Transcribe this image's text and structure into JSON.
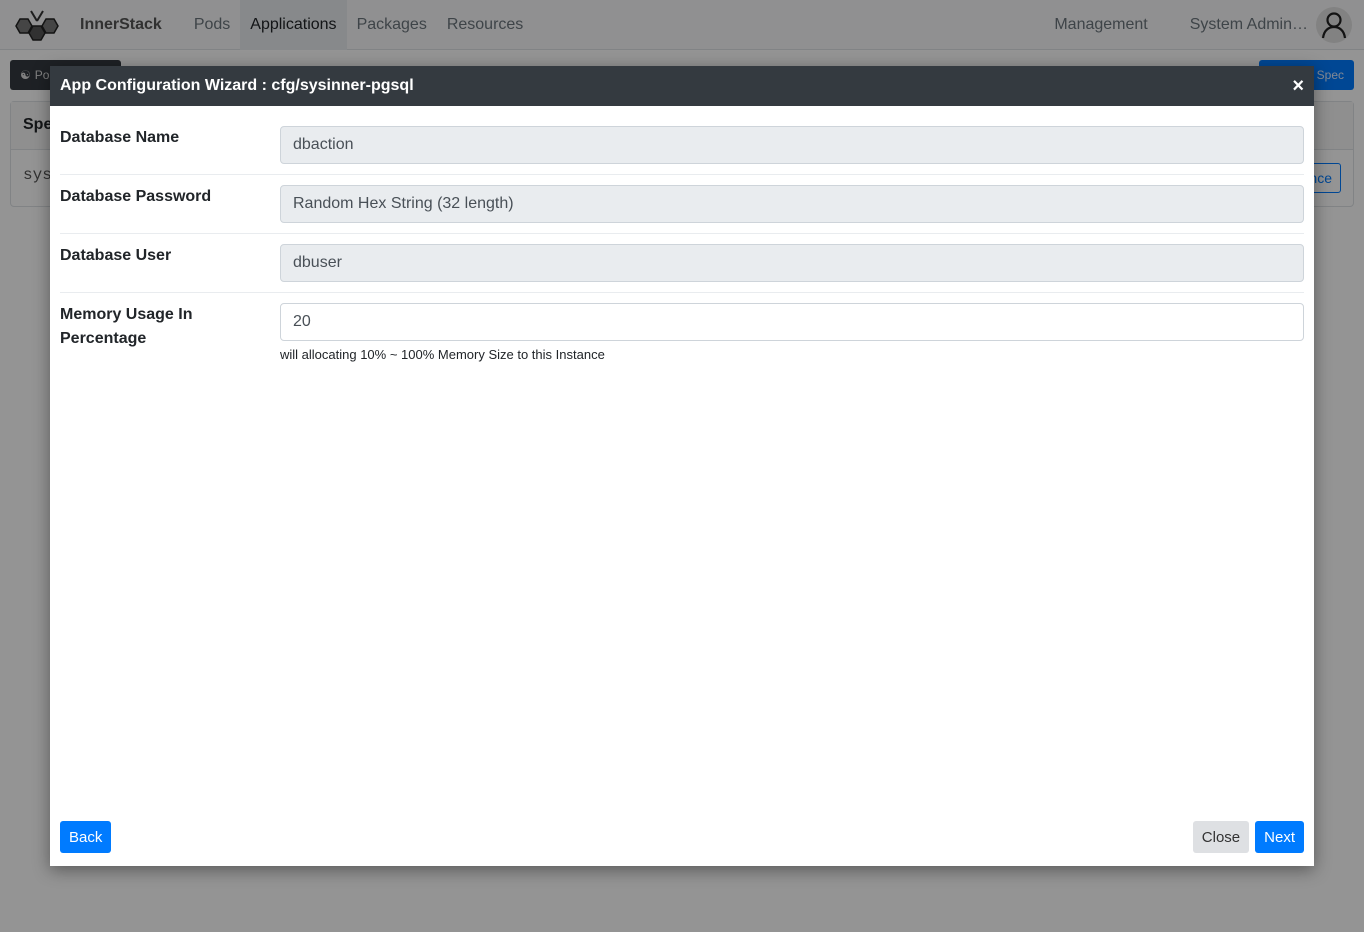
{
  "navbar": {
    "brand": "InnerStack",
    "items": [
      {
        "label": "Pods",
        "active": false
      },
      {
        "label": "Applications",
        "active": true
      },
      {
        "label": "Packages",
        "active": false
      },
      {
        "label": "Resources",
        "active": false
      }
    ],
    "management": "Management",
    "user": "System Admin…"
  },
  "background": {
    "pods_button": "Po",
    "spec_button": "Spec",
    "card_header": "Spe",
    "card_row_text": "sys",
    "instance_button": "nce"
  },
  "modal": {
    "title": "App Configuration Wizard : cfg/sysinner-pgsql",
    "close_glyph": "×",
    "fields": [
      {
        "label": "Database Name",
        "value": "dbaction",
        "readonly": true
      },
      {
        "label": "Database Password",
        "value": "Random Hex String (32 length)",
        "readonly": true
      },
      {
        "label": "Database User",
        "value": "dbuser",
        "readonly": true
      },
      {
        "label": "Memory Usage In Percentage",
        "value": "20",
        "readonly": false,
        "help": "will allocating 10% ~ 100% Memory Size to this Instance"
      }
    ],
    "buttons": {
      "back": "Back",
      "close": "Close",
      "next": "Next"
    }
  }
}
